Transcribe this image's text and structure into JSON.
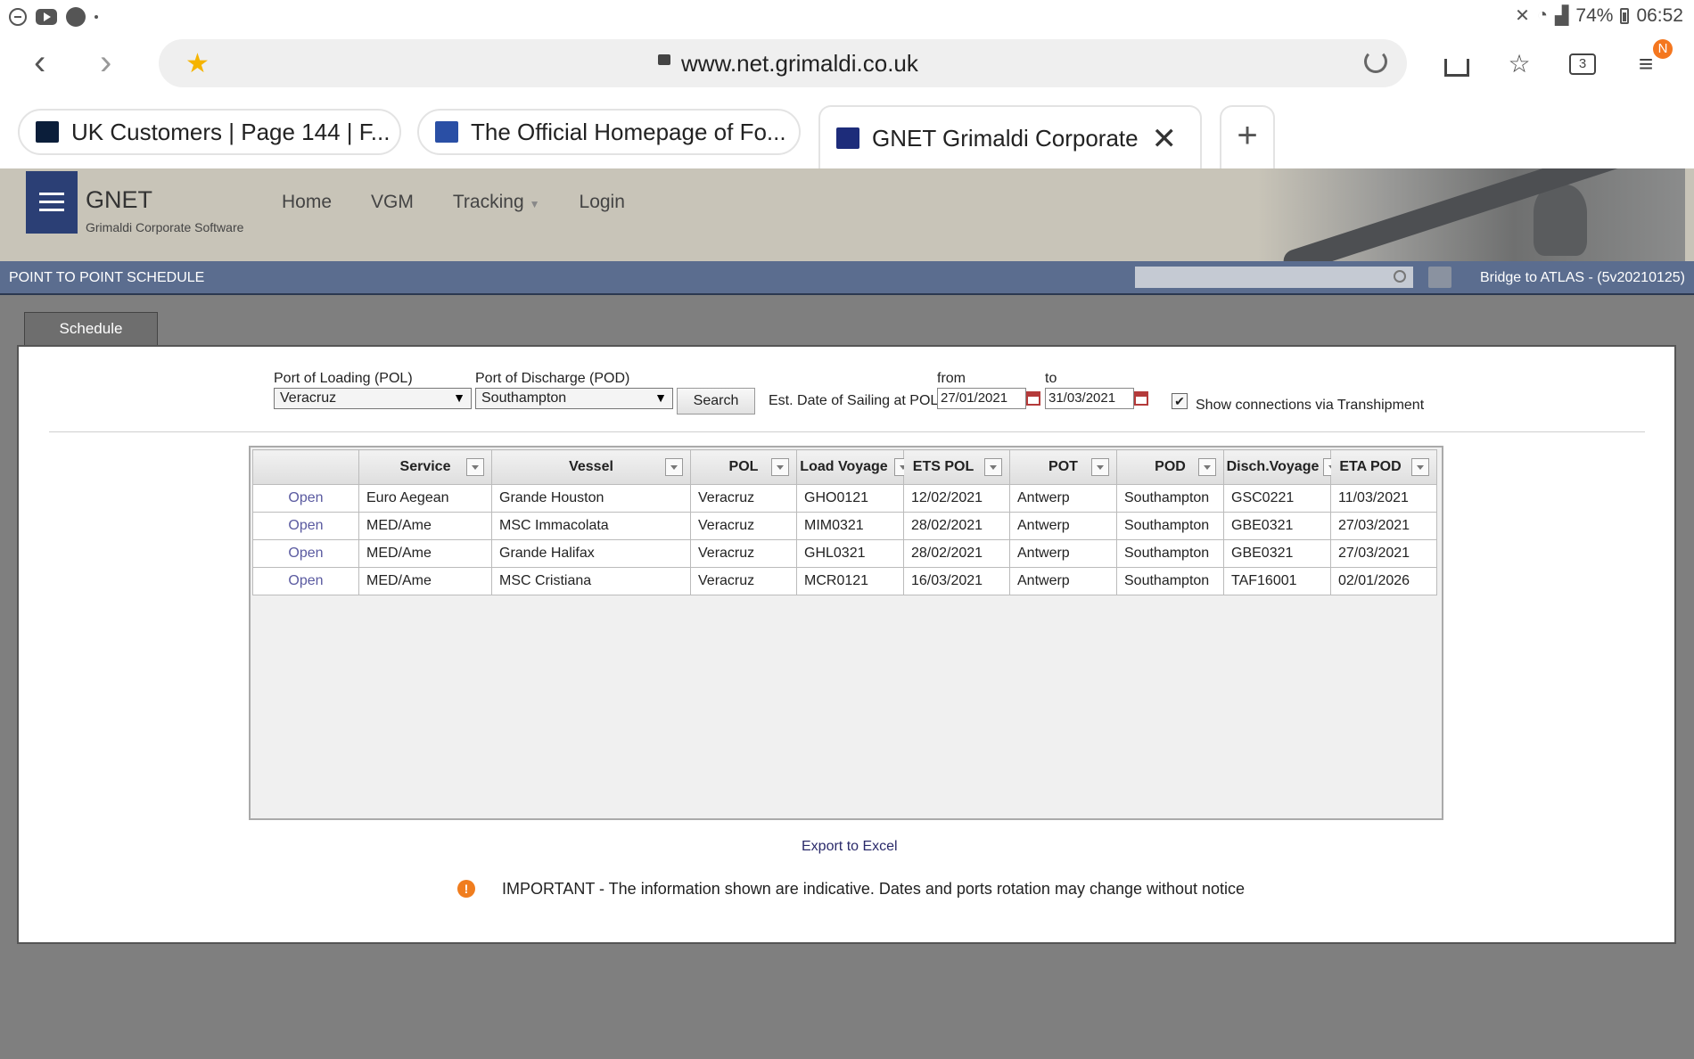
{
  "status_bar": {
    "battery": "74%",
    "time": "06:52"
  },
  "browser": {
    "url": "www.net.grimaldi.co.uk",
    "tab_count": "3",
    "profile_badge": "N",
    "tabs": [
      {
        "title": "UK Customers | Page 144 | F..."
      },
      {
        "title": "The Official Homepage of Fo..."
      },
      {
        "title": "GNET Grimaldi Corporate"
      }
    ]
  },
  "site": {
    "brand": "GNET",
    "brand_sub": "Grimaldi Corporate Software",
    "nav": [
      "Home",
      "VGM",
      "Tracking",
      "Login"
    ],
    "page_title": "POINT TO POINT SCHEDULE",
    "version": "Bridge to ATLAS - (5v20210125)"
  },
  "schedule": {
    "tab_label": "Schedule",
    "pol_label": "Port of Loading (POL)",
    "pol_value": "Veracruz",
    "pod_label": "Port of Discharge (POD)",
    "pod_value": "Southampton",
    "search_label": "Search",
    "est_date_label": "Est. Date of Sailing at POL",
    "from_label": "from",
    "from_value": "27/01/2021",
    "to_label": "to",
    "to_value": "31/03/2021",
    "transhipment_label": "Show connections via Transhipment",
    "transhipment_checked": true
  },
  "grid": {
    "columns": [
      "",
      "Service",
      "Vessel",
      "POL",
      "Load Voyage",
      "ETS POL",
      "POT",
      "POD",
      "Disch.Voyage",
      "ETA POD"
    ],
    "rows": [
      [
        "Open",
        "Euro Aegean",
        "Grande Houston",
        "Veracruz",
        "GHO0121",
        "12/02/2021",
        "Antwerp",
        "Southampton",
        "GSC0221",
        "11/03/2021"
      ],
      [
        "Open",
        "MED/Ame",
        "MSC Immacolata",
        "Veracruz",
        "MIM0321",
        "28/02/2021",
        "Antwerp",
        "Southampton",
        "GBE0321",
        "27/03/2021"
      ],
      [
        "Open",
        "MED/Ame",
        "Grande Halifax",
        "Veracruz",
        "GHL0321",
        "28/02/2021",
        "Antwerp",
        "Southampton",
        "GBE0321",
        "27/03/2021"
      ],
      [
        "Open",
        "MED/Ame",
        "MSC Cristiana",
        "Veracruz",
        "MCR0121",
        "16/03/2021",
        "Antwerp",
        "Southampton",
        "TAF16001",
        "02/01/2026"
      ]
    ]
  },
  "footer": {
    "export_label": "Export to Excel",
    "notice": "IMPORTANT - The information shown are indicative. Dates and ports rotation may change without notice"
  },
  "colors": {
    "header_blue": "#5b6d8f",
    "hamburger_blue": "#2b3f75",
    "notice_orange": "#f07d1e"
  }
}
